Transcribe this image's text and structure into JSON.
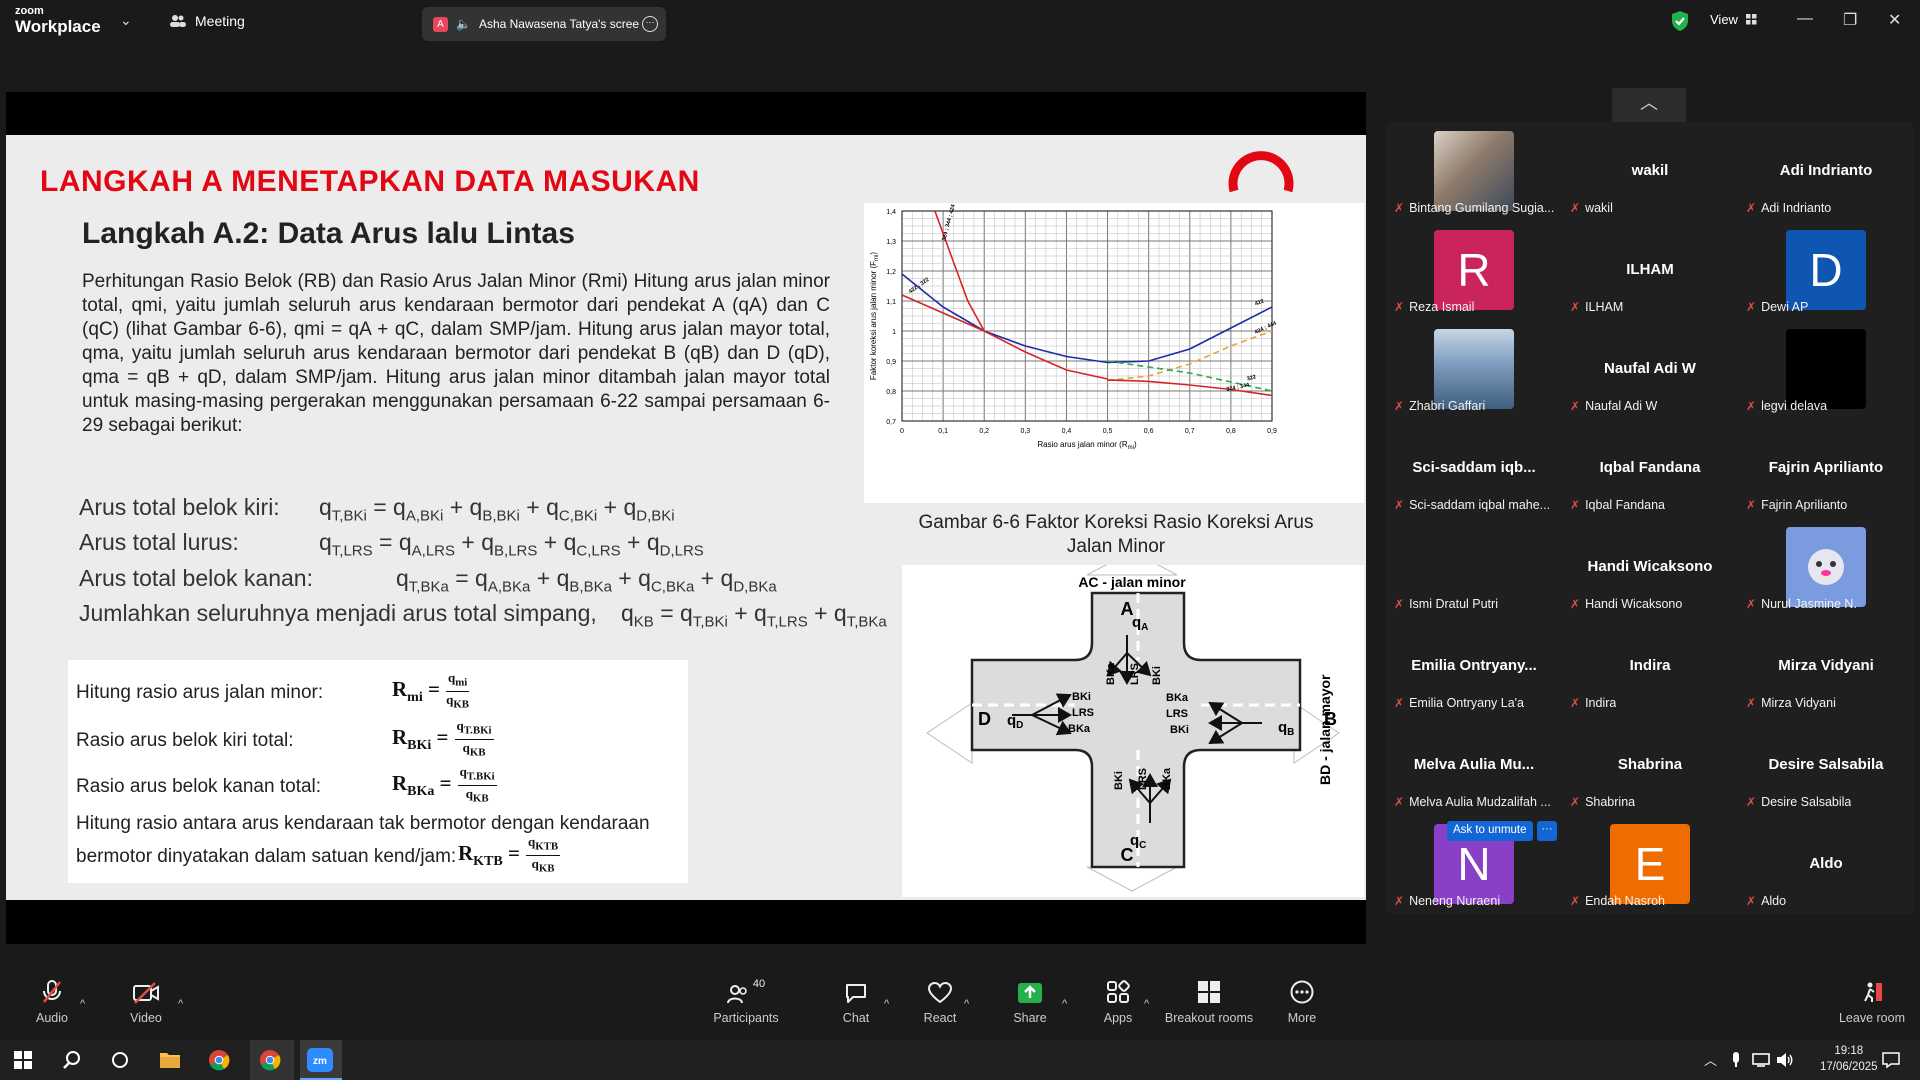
{
  "titlebar": {
    "brand_small": "zoom",
    "brand_big": "Workplace",
    "meeting_label": "Meeting",
    "share_tab_label": "Asha Nawasena Tatya's scree",
    "share_badge": "A",
    "view_label": "View"
  },
  "slide": {
    "heading": "LANGKAH A MENETAPKAN DATA MASUKAN",
    "subheading": "Langkah A.2: Data Arus lalu Lintas",
    "paragraph": "Perhitungan Rasio Belok (RB) dan Rasio Arus Jalan Minor (Rmi) Hitung arus jalan minor total, qmi, yaitu jumlah seluruh arus kendaraan bermotor dari pendekat A (qA) dan C (qC) (lihat Gambar 6-6), qmi = qA + qC, dalam SMP/jam. Hitung arus jalan mayor total, qma, yaitu jumlah seluruh arus kendaraan bermotor dari pendekat B (qB) dan D (qD), qma = qB + qD, dalam SMP/jam. Hitung arus jalan minor ditambah jalan mayor total untuk masing-masing pergerakan menggunakan persamaan 6-22 sampai persamaan 6-29 sebagai berikut:",
    "eq_labels": [
      "Arus total belok kiri:",
      "Arus total lurus:",
      "Arus total belok kanan:",
      "Jumlahkan seluruhnya menjadi arus total simpang,"
    ],
    "eq_formulas": [
      "q<sub>T,BKi</sub> = q<sub>A,BKi</sub> + q<sub>B,BKi</sub> + q<sub>C,BKi</sub> + q<sub>D,BKi</sub>",
      "q<sub>T,LRS</sub> = q<sub>A,LRS</sub> + q<sub>B,LRS</sub> + q<sub>C,LRS</sub> + q<sub>D,LRS</sub>",
      "q<sub>T,BKa</sub> = q<sub>A,BKa</sub> + q<sub>B,BKa</sub> + q<sub>C,BKa</sub> + q<sub>D,BKa</sub>",
      "q<sub>KB</sub> = q<sub>T,BKi</sub> + q<sub>T,LRS</sub> + q<sub>T,BKa</sub>"
    ],
    "ratio_labels": [
      "Hitung rasio arus jalan minor:",
      "Rasio arus belok kiri total:",
      "Rasio arus belok kanan total:"
    ],
    "ratio_lhs": [
      "R",
      "R",
      "R"
    ],
    "ratio_sub": [
      "mi",
      "BKi",
      "BKa"
    ],
    "ratio_num": [
      "q<sub>mi</sub>",
      "q<sub>T.BKi</sub>",
      "q<sub>T.BKi</sub>"
    ],
    "ratio_den": [
      "q<sub>KB</sub>",
      "q<sub>KB</sub>",
      "q<sub>KB</sub>"
    ],
    "ktb_text_1": "Hitung rasio antara arus kendaraan tak bermotor dengan kendaraan",
    "ktb_text_2": "bermotor dinyatakan dalam satuan kend/jam:",
    "ktb_lhs": "R",
    "ktb_sub": "KTB",
    "ktb_num": "q<sub>KTB</sub>",
    "ktb_den": "q<sub>KB</sub>",
    "figure_caption": "Gambar 6-6 Faktor Koreksi Rasio Koreksi Arus Jalan Minor",
    "diagram": {
      "title": "AC - jalan minor",
      "side_label": "BD - jalan mayor",
      "approaches": [
        "A",
        "B",
        "C",
        "D"
      ],
      "flows": [
        "q",
        "A",
        "q",
        "B",
        "q",
        "C",
        "q",
        "D"
      ],
      "movements": [
        "BKi",
        "LRS",
        "BKa"
      ]
    }
  },
  "chart_data": {
    "type": "line",
    "xlabel": "Rasio arus jalan minor (R",
    "xlabel_sub": "mi",
    "xlabel_end": ")",
    "ylabel": "Faktor koreksi arus jalan minor (F",
    "ylabel_sub": "mi",
    "ylabel_end": ")",
    "xlim": [
      0,
      0.9
    ],
    "ylim": [
      0.7,
      1.4
    ],
    "x_ticks": [
      "0",
      "0,1",
      "0,2",
      "0,3",
      "0,4",
      "0,5",
      "0,6",
      "0,7",
      "0,8",
      "0,9"
    ],
    "y_ticks": [
      "0,7",
      "0,8",
      "0,9",
      "1",
      "1,1",
      "1,2",
      "1,3",
      "1,4"
    ],
    "series": [
      {
        "name": "422",
        "color": "#1e2ba6",
        "dash": "",
        "points": [
          [
            0,
            1.19
          ],
          [
            0.1,
            1.08
          ],
          [
            0.2,
            1.0
          ],
          [
            0.3,
            0.95
          ],
          [
            0.4,
            0.915
          ],
          [
            0.5,
            0.895
          ],
          [
            0.6,
            0.9
          ],
          [
            0.7,
            0.94
          ],
          [
            0.8,
            1.01
          ],
          [
            0.9,
            1.08
          ]
        ]
      },
      {
        "name": "424 ; 444",
        "color": "#e8a23a",
        "dash": "6,4",
        "points": [
          [
            0.5,
            0.835
          ],
          [
            0.6,
            0.85
          ],
          [
            0.7,
            0.89
          ],
          [
            0.8,
            0.95
          ],
          [
            0.9,
            1.0
          ]
        ]
      },
      {
        "name": "322",
        "color": "#2fa84a",
        "dash": "6,4",
        "points": [
          [
            0.5,
            0.9
          ],
          [
            0.6,
            0.88
          ],
          [
            0.7,
            0.86
          ],
          [
            0.8,
            0.83
          ],
          [
            0.9,
            0.8
          ]
        ]
      },
      {
        "name": "324 ; 344",
        "color": "#d42525",
        "dash": "",
        "points": [
          [
            0.5,
            0.837
          ],
          [
            0.6,
            0.832
          ],
          [
            0.7,
            0.82
          ],
          [
            0.8,
            0.805
          ],
          [
            0.9,
            0.785
          ]
        ]
      },
      {
        "name": "422 ; 322",
        "color": "#d42525",
        "dash": "",
        "points": [
          [
            0,
            1.12
          ],
          [
            0.1,
            1.06
          ],
          [
            0.2,
            1.0
          ],
          [
            0.3,
            0.93
          ],
          [
            0.4,
            0.87
          ],
          [
            0.5,
            0.84
          ]
        ]
      },
      {
        "name": "324 ; 344 ; 424 ; 444",
        "color": "#d42525",
        "dash": "",
        "points": [
          [
            0.08,
            1.4
          ],
          [
            0.12,
            1.25
          ],
          [
            0.16,
            1.1
          ],
          [
            0.2,
            1.0
          ]
        ]
      }
    ]
  },
  "participants": [
    {
      "name": "",
      "label": "Bintang Gumilang Sugia...",
      "avatar": "photo-portrait",
      "color": "#6f7f8c"
    },
    {
      "name": "wakil",
      "label": "wakil"
    },
    {
      "name": "Adi Indrianto",
      "label": "Adi Indrianto"
    },
    {
      "name": "",
      "label": "Reza Ismail",
      "avatar": "R",
      "color": "#c9245e"
    },
    {
      "name": "ILHAM",
      "label": "ILHAM"
    },
    {
      "name": "",
      "label": "Dewi AP",
      "avatar": "D",
      "color": "#0f56b3"
    },
    {
      "name": "",
      "label": "Zhabri Gaffari",
      "avatar": "photo-city",
      "color": "#5a7fa6"
    },
    {
      "name": "Naufal Adi W",
      "label": "Naufal Adi W"
    },
    {
      "name": "",
      "label": "legvi delava",
      "avatar": "",
      "color": "#000000"
    },
    {
      "name": "Sci-saddam  iqb...",
      "label": "Sci-saddam iqbal mahe..."
    },
    {
      "name": "Iqbal Fandana",
      "label": "Iqbal Fandana"
    },
    {
      "name": "Fajrin Aprilianto",
      "label": "Fajrin Aprilianto"
    },
    {
      "name": "",
      "label": "Ismi Dratul Putri"
    },
    {
      "name": "Handi Wicaksono",
      "label": "Handi Wicaksono"
    },
    {
      "name": "",
      "label": "Nurul Jasmine N.",
      "avatar": "photo-cartoon",
      "color": "#7a9be0"
    },
    {
      "name": "Emilia  Ontryany...",
      "label": "Emilia Ontryany La'a"
    },
    {
      "name": "Indira",
      "label": "Indira"
    },
    {
      "name": "Mirza Vidyani",
      "label": "Mirza Vidyani"
    },
    {
      "name": "Melva  Aulia  Mu...",
      "label": "Melva Aulia Mudzalifah ..."
    },
    {
      "name": "Shabrina",
      "label": "Shabrina"
    },
    {
      "name": "Desire Salsabila",
      "label": "Desire Salsabila"
    },
    {
      "name": "",
      "label": "Neneng Nuraeni",
      "avatar": "N",
      "color": "#8a3fc7"
    },
    {
      "name": "",
      "label": "Endah Nasroh",
      "avatar": "E",
      "color": "#ef6c00"
    },
    {
      "name": "Aldo",
      "label": "Aldo"
    }
  ],
  "ask_to_unmute": "Ask to unmute",
  "ask_dots": "···",
  "toolbar": {
    "audio": "Audio",
    "video": "Video",
    "participants": "Participants",
    "participants_count": "40",
    "chat": "Chat",
    "react": "React",
    "share": "Share",
    "apps": "Apps",
    "breakout": "Breakout rooms",
    "more": "More",
    "leave": "Leave room"
  },
  "taskbar": {
    "time": "19:18",
    "date": "17/06/2025"
  }
}
